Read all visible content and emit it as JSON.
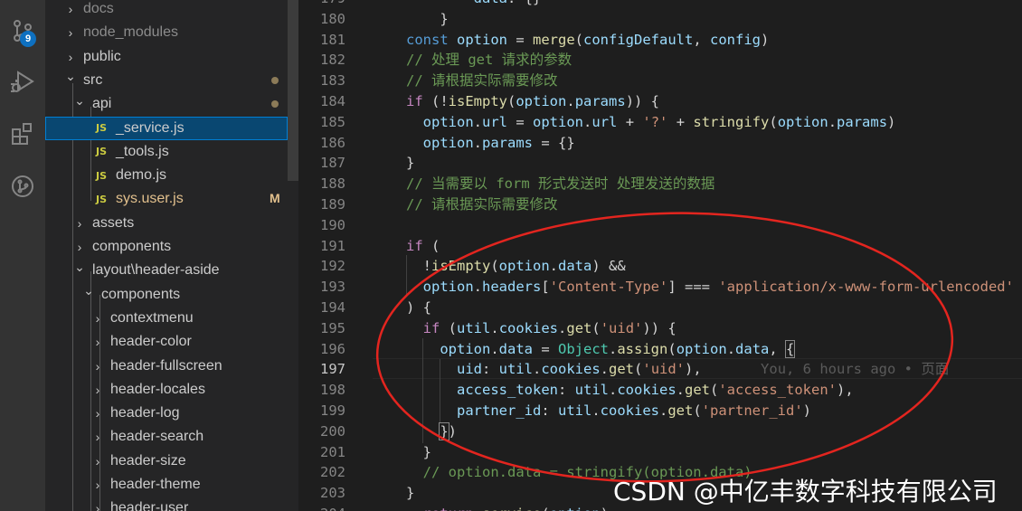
{
  "activity_bar": {
    "scm_badge": "9"
  },
  "explorer": {
    "items": [
      {
        "label": "docs",
        "kind": "folder-closed",
        "indent": 0,
        "style": "dim"
      },
      {
        "label": "node_modules",
        "kind": "folder-closed",
        "indent": 0,
        "style": "dim"
      },
      {
        "label": "public",
        "kind": "folder-closed",
        "indent": 0,
        "style": ""
      },
      {
        "label": "src",
        "kind": "folder-open",
        "indent": 0,
        "style": "",
        "decoration": "dot"
      },
      {
        "label": "api",
        "kind": "folder-open",
        "indent": 1,
        "style": "",
        "decoration": "dot"
      },
      {
        "label": "_service.js",
        "kind": "js",
        "indent": 2,
        "style": "",
        "selected": true
      },
      {
        "label": "_tools.js",
        "kind": "js",
        "indent": 2,
        "style": ""
      },
      {
        "label": "demo.js",
        "kind": "js",
        "indent": 2,
        "style": ""
      },
      {
        "label": "sys.user.js",
        "kind": "js",
        "indent": 2,
        "style": "mod",
        "decoration": "M"
      },
      {
        "label": "assets",
        "kind": "folder-closed",
        "indent": 1,
        "style": ""
      },
      {
        "label": "components",
        "kind": "folder-closed",
        "indent": 1,
        "style": ""
      },
      {
        "label": "layout\\header-aside",
        "kind": "folder-open",
        "indent": 1,
        "style": ""
      },
      {
        "label": "components",
        "kind": "folder-open",
        "indent": 2,
        "style": ""
      },
      {
        "label": "contextmenu",
        "kind": "folder-closed",
        "indent": 3,
        "style": ""
      },
      {
        "label": "header-color",
        "kind": "folder-closed",
        "indent": 3,
        "style": ""
      },
      {
        "label": "header-fullscreen",
        "kind": "folder-closed",
        "indent": 3,
        "style": ""
      },
      {
        "label": "header-locales",
        "kind": "folder-closed",
        "indent": 3,
        "style": ""
      },
      {
        "label": "header-log",
        "kind": "folder-closed",
        "indent": 3,
        "style": ""
      },
      {
        "label": "header-search",
        "kind": "folder-closed",
        "indent": 3,
        "style": ""
      },
      {
        "label": "header-size",
        "kind": "folder-closed",
        "indent": 3,
        "style": ""
      },
      {
        "label": "header-theme",
        "kind": "folder-closed",
        "indent": 3,
        "style": ""
      },
      {
        "label": "header-user",
        "kind": "folder-closed",
        "indent": 3,
        "style": ""
      }
    ],
    "js_badge": "JS",
    "modified_flag": "M"
  },
  "editor": {
    "active_line": 197,
    "lines": [
      {
        "n": "179",
        "tokens": [
          [
            "        ",
            "pu"
          ],
          [
            "data",
            "vr"
          ],
          [
            ": {}",
            "pu"
          ]
        ]
      },
      {
        "n": "180",
        "tokens": [
          [
            "    }",
            "pu"
          ]
        ]
      },
      {
        "n": "181",
        "tokens": [
          [
            "const ",
            "kw"
          ],
          [
            "option",
            "vr"
          ],
          [
            " = ",
            "pu"
          ],
          [
            "merge",
            "fn"
          ],
          [
            "(",
            "pu"
          ],
          [
            "configDefault",
            "vr"
          ],
          [
            ", ",
            "pu"
          ],
          [
            "config",
            "vr"
          ],
          [
            ")",
            "pu"
          ]
        ]
      },
      {
        "n": "182",
        "tokens": [
          [
            "// 处理 get 请求的参数",
            "cm"
          ]
        ]
      },
      {
        "n": "183",
        "tokens": [
          [
            "// 请根据实际需要修改",
            "cm"
          ]
        ]
      },
      {
        "n": "184",
        "tokens": [
          [
            "if",
            "ctl"
          ],
          [
            " (!",
            "pu"
          ],
          [
            "isEmpty",
            "fn"
          ],
          [
            "(",
            "pu"
          ],
          [
            "option",
            "vr"
          ],
          [
            ".",
            "pu"
          ],
          [
            "params",
            "vr"
          ],
          [
            ")) {",
            "pu"
          ]
        ]
      },
      {
        "n": "185",
        "tokens": [
          [
            "  ",
            "pu"
          ],
          [
            "option",
            "vr"
          ],
          [
            ".",
            "pu"
          ],
          [
            "url",
            "vr"
          ],
          [
            " = ",
            "pu"
          ],
          [
            "option",
            "vr"
          ],
          [
            ".",
            "pu"
          ],
          [
            "url",
            "vr"
          ],
          [
            " + ",
            "pu"
          ],
          [
            "'?'",
            "st"
          ],
          [
            " + ",
            "pu"
          ],
          [
            "stringify",
            "fn"
          ],
          [
            "(",
            "pu"
          ],
          [
            "option",
            "vr"
          ],
          [
            ".",
            "pu"
          ],
          [
            "params",
            "vr"
          ],
          [
            ")",
            "pu"
          ]
        ]
      },
      {
        "n": "186",
        "tokens": [
          [
            "  ",
            "pu"
          ],
          [
            "option",
            "vr"
          ],
          [
            ".",
            "pu"
          ],
          [
            "params",
            "vr"
          ],
          [
            " = {}",
            "pu"
          ]
        ]
      },
      {
        "n": "187",
        "tokens": [
          [
            "}",
            "pu"
          ]
        ]
      },
      {
        "n": "188",
        "tokens": [
          [
            "// 当需要以 form 形式发送时 处理发送的数据",
            "cm"
          ]
        ]
      },
      {
        "n": "189",
        "tokens": [
          [
            "// 请根据实际需要修改",
            "cm"
          ]
        ]
      },
      {
        "n": "190",
        "tokens": []
      },
      {
        "n": "191",
        "tokens": [
          [
            "if",
            "ctl"
          ],
          [
            " (",
            "pu"
          ]
        ]
      },
      {
        "n": "192",
        "tokens": [
          [
            "  !",
            "pu"
          ],
          [
            "isEmpty",
            "fn"
          ],
          [
            "(",
            "pu"
          ],
          [
            "option",
            "vr"
          ],
          [
            ".",
            "pu"
          ],
          [
            "data",
            "vr"
          ],
          [
            ") &&",
            "pu"
          ]
        ]
      },
      {
        "n": "193",
        "tokens": [
          [
            "  ",
            "pu"
          ],
          [
            "option",
            "vr"
          ],
          [
            ".",
            "pu"
          ],
          [
            "headers",
            "vr"
          ],
          [
            "[",
            "pu"
          ],
          [
            "'Content-Type'",
            "st"
          ],
          [
            "] === ",
            "pu"
          ],
          [
            "'application/x-www-form-urlencoded'",
            "st"
          ]
        ]
      },
      {
        "n": "194",
        "tokens": [
          [
            ") {",
            "pu"
          ]
        ]
      },
      {
        "n": "195",
        "tokens": [
          [
            "  ",
            "pu"
          ],
          [
            "if",
            "ctl"
          ],
          [
            " (",
            "pu"
          ],
          [
            "util",
            "vr"
          ],
          [
            ".",
            "pu"
          ],
          [
            "cookies",
            "vr"
          ],
          [
            ".",
            "pu"
          ],
          [
            "get",
            "fn"
          ],
          [
            "(",
            "pu"
          ],
          [
            "'uid'",
            "st"
          ],
          [
            ")) {",
            "pu"
          ]
        ]
      },
      {
        "n": "196",
        "tokens": [
          [
            "    ",
            "pu"
          ],
          [
            "option",
            "vr"
          ],
          [
            ".",
            "pu"
          ],
          [
            "data",
            "vr"
          ],
          [
            " = ",
            "pu"
          ],
          [
            "Object",
            "ty"
          ],
          [
            ".",
            "pu"
          ],
          [
            "assign",
            "fn"
          ],
          [
            "(",
            "pu"
          ],
          [
            "option",
            "vr"
          ],
          [
            ".",
            "pu"
          ],
          [
            "data",
            "vr"
          ],
          [
            ", ",
            "pu"
          ],
          [
            "{",
            "pu bracket"
          ]
        ]
      },
      {
        "n": "197",
        "tokens": [
          [
            "      ",
            "pu"
          ],
          [
            "uid",
            "vr"
          ],
          [
            ": ",
            "pu"
          ],
          [
            "util",
            "vr"
          ],
          [
            ".",
            "pu"
          ],
          [
            "cookies",
            "vr"
          ],
          [
            ".",
            "pu"
          ],
          [
            "get",
            "fn"
          ],
          [
            "(",
            "pu"
          ],
          [
            "'uid'",
            "st"
          ],
          [
            "),",
            "pu"
          ],
          [
            "       You, 6 hours ago • 页面",
            "ghost"
          ]
        ]
      },
      {
        "n": "198",
        "tokens": [
          [
            "      ",
            "pu"
          ],
          [
            "access_token",
            "vr"
          ],
          [
            ": ",
            "pu"
          ],
          [
            "util",
            "vr"
          ],
          [
            ".",
            "pu"
          ],
          [
            "cookies",
            "vr"
          ],
          [
            ".",
            "pu"
          ],
          [
            "get",
            "fn"
          ],
          [
            "(",
            "pu"
          ],
          [
            "'access_token'",
            "st"
          ],
          [
            "),",
            "pu"
          ]
        ]
      },
      {
        "n": "199",
        "tokens": [
          [
            "      ",
            "pu"
          ],
          [
            "partner_id",
            "vr"
          ],
          [
            ": ",
            "pu"
          ],
          [
            "util",
            "vr"
          ],
          [
            ".",
            "pu"
          ],
          [
            "cookies",
            "vr"
          ],
          [
            ".",
            "pu"
          ],
          [
            "get",
            "fn"
          ],
          [
            "(",
            "pu"
          ],
          [
            "'partner_id'",
            "st"
          ],
          [
            ")",
            "pu"
          ]
        ]
      },
      {
        "n": "200",
        "tokens": [
          [
            "    ",
            "pu"
          ],
          [
            "}",
            "pu bracket"
          ],
          [
            ")",
            "pu"
          ]
        ]
      },
      {
        "n": "201",
        "tokens": [
          [
            "  }",
            "pu"
          ]
        ]
      },
      {
        "n": "202",
        "tokens": [
          [
            "  ",
            "pu"
          ],
          [
            "// option.data = stringify(option.data)",
            "cm"
          ]
        ]
      },
      {
        "n": "203",
        "tokens": [
          [
            "}",
            "pu"
          ]
        ]
      },
      {
        "n": "204",
        "tokens": [
          [
            "  ",
            "pu"
          ],
          [
            "return ",
            "ctl"
          ],
          [
            "service",
            "fn"
          ],
          [
            "(",
            "pu"
          ],
          [
            "option",
            "vr"
          ],
          [
            ")",
            "pu"
          ]
        ]
      }
    ]
  },
  "watermark": "CSDN @中亿丰数字科技有限公司"
}
